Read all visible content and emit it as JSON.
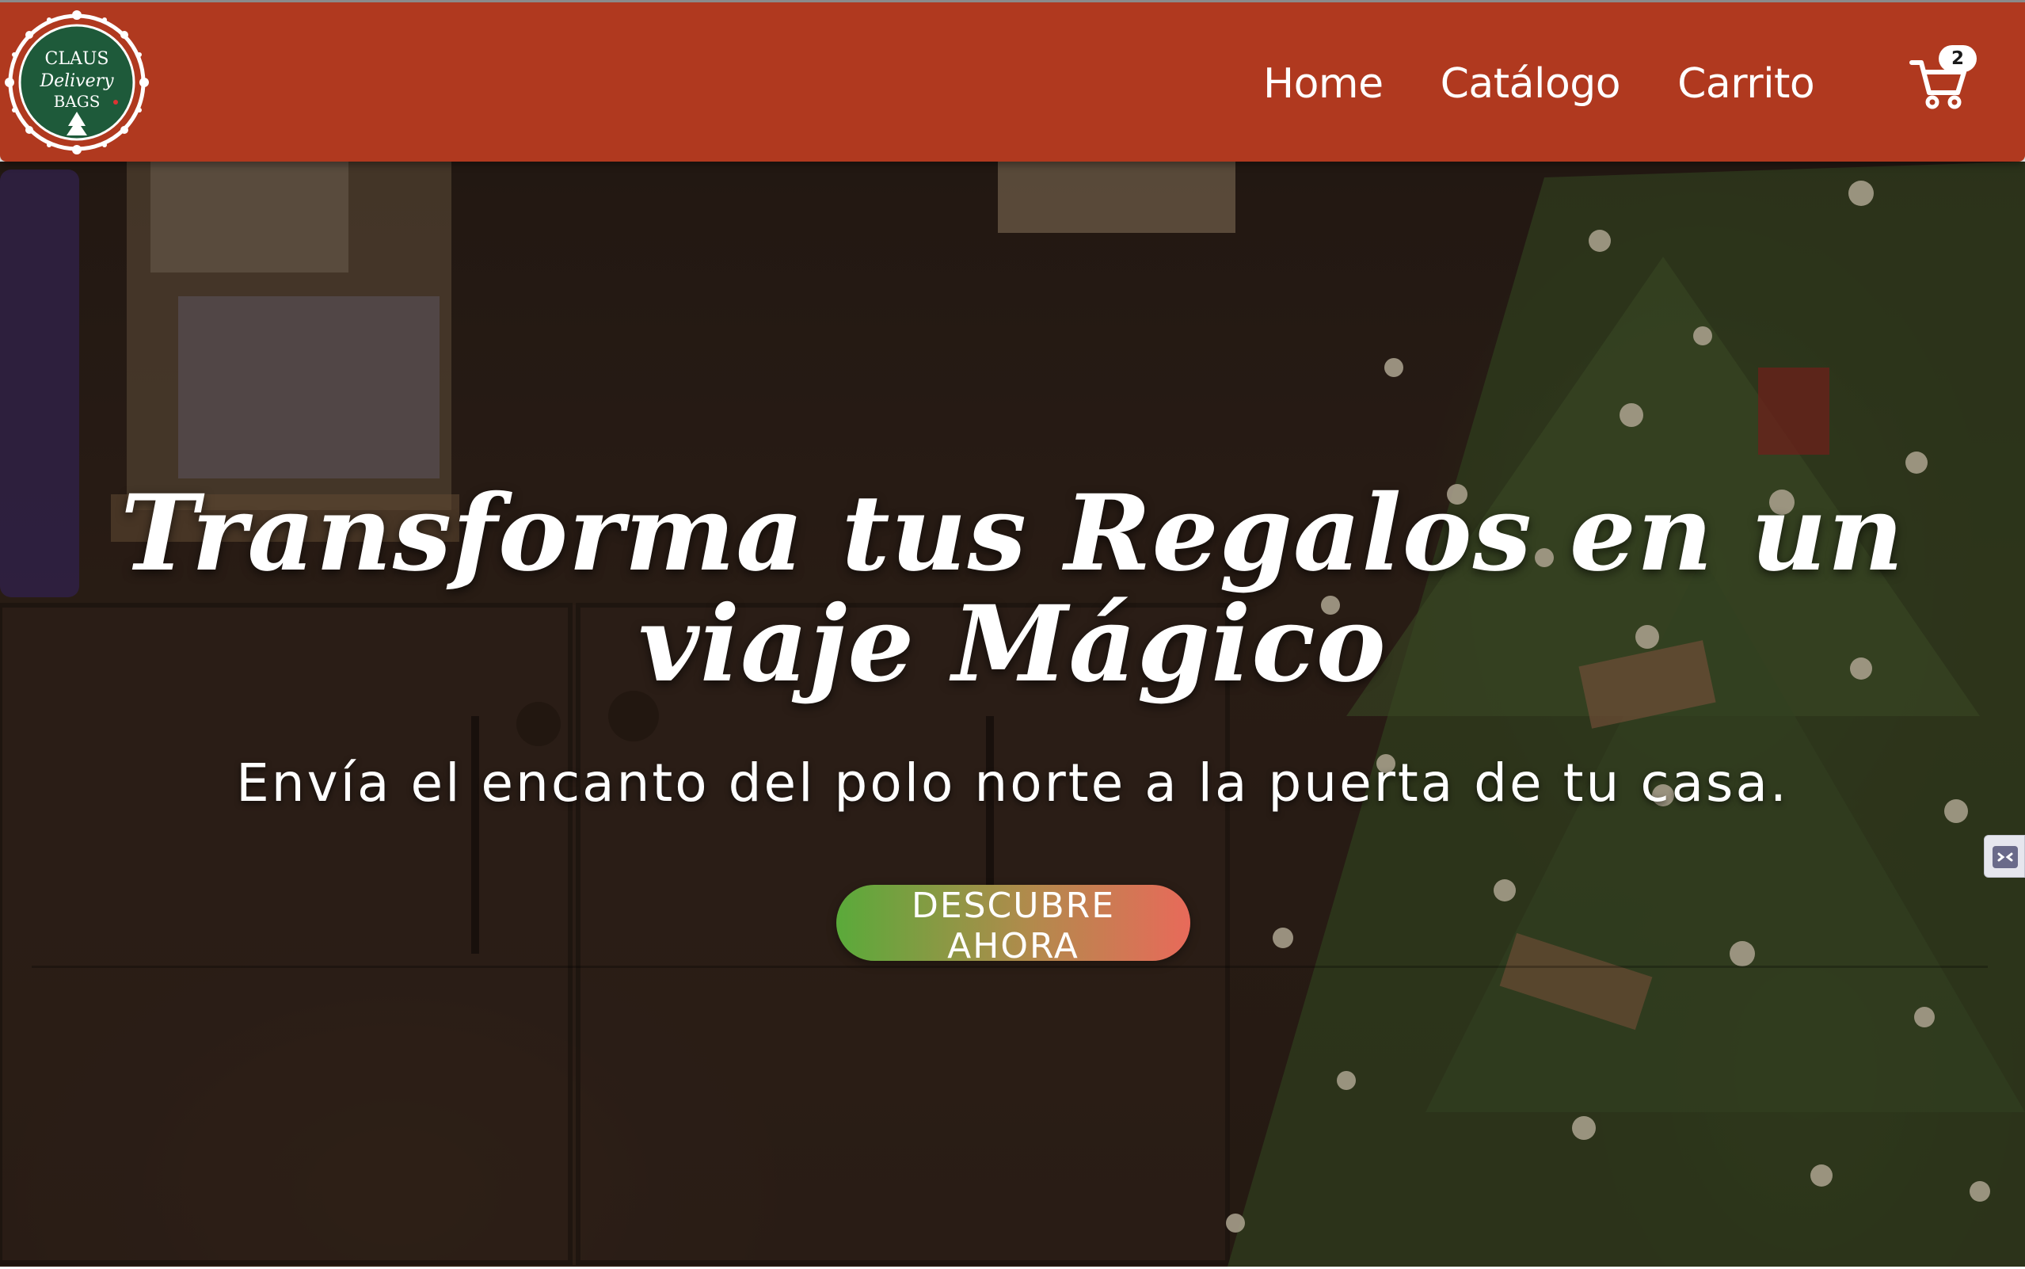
{
  "logo": {
    "line1": "CLAUS",
    "line2": "Delivery",
    "line3": "BAGS"
  },
  "nav": {
    "items": [
      {
        "label": "Home"
      },
      {
        "label": "Catálogo"
      },
      {
        "label": "Carrito"
      }
    ]
  },
  "cart": {
    "count": "2"
  },
  "hero": {
    "title": "Transforma tus Regalos en un viaje Mágico",
    "subtitle": "Envía el encanto del polo norte a la puerta de tu casa.",
    "cta_label": "DESCUBRE AHORA"
  },
  "colors": {
    "navbar": "#b0391f",
    "logo_badge": "#1e5a3a",
    "cta_start": "#5aaa3a",
    "cta_end": "#e86a5a"
  },
  "icons": {
    "cart": "cart-icon",
    "side_widget": "code-icon"
  }
}
